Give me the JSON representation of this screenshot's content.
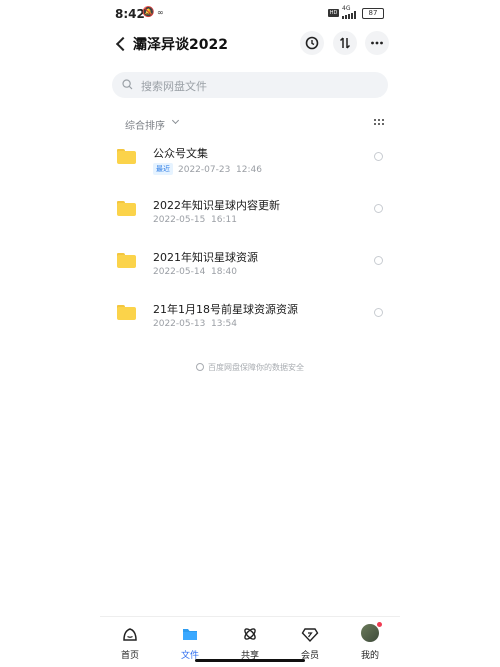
{
  "status": {
    "time": "8:42",
    "network": "4G",
    "battery": "87"
  },
  "header": {
    "title": "灞泽异谈2022"
  },
  "search": {
    "placeholder": "搜索网盘文件"
  },
  "sort": {
    "label": "综合排序"
  },
  "files": [
    {
      "name": "公众号文集",
      "badge": "最近",
      "date": "2022-07-23",
      "time": "12:46"
    },
    {
      "name": "2022年知识星球内容更新",
      "badge": "",
      "date": "2022-05-15",
      "time": "16:11"
    },
    {
      "name": "2021年知识星球资源",
      "badge": "",
      "date": "2022-05-14",
      "time": "18:40"
    },
    {
      "name": "21年1月18号前星球资源资源",
      "badge": "",
      "date": "2022-05-13",
      "time": "13:54"
    }
  ],
  "footer_note": "百度网盘保障你的数据安全",
  "tabs": [
    {
      "label": "首页",
      "icon": "home-icon"
    },
    {
      "label": "文件",
      "icon": "folder-icon",
      "active": true
    },
    {
      "label": "共享",
      "icon": "share-icon"
    },
    {
      "label": "会员",
      "icon": "vip-icon"
    },
    {
      "label": "我的",
      "icon": "avatar"
    }
  ],
  "colors": {
    "accent": "#2c6cf0",
    "folder": "#fbd34a",
    "badge_text": "#2e7de6"
  }
}
